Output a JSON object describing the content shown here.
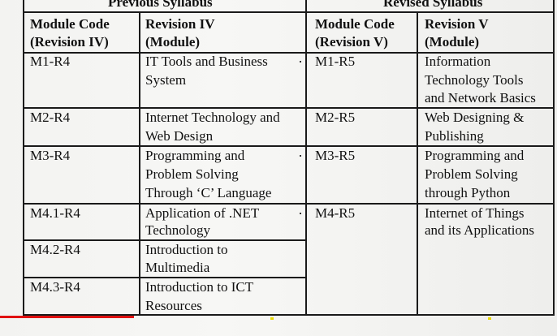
{
  "table": {
    "group_headers": {
      "previous": "Previous Syllabus",
      "revised": "Revised Syllabus"
    },
    "column_headers": {
      "prev_code": [
        "Module Code",
        "(Revision IV)"
      ],
      "prev_module": [
        "Revision IV",
        "(Module)"
      ],
      "rev_code": [
        "Module Code",
        "(Revision V)"
      ],
      "rev_module": [
        "Revision V",
        "(Module)"
      ]
    },
    "previous_rows": [
      {
        "code": "M1-R4",
        "module": [
          "IT Tools and Business",
          "System"
        ]
      },
      {
        "code": "M2-R4",
        "module": [
          "Internet Technology and",
          "Web Design"
        ]
      },
      {
        "code": "M3-R4",
        "module": [
          "Programming and",
          "Problem Solving",
          "Through ‘C’ Language"
        ]
      },
      {
        "code": "M4.1-R4",
        "module": [
          "Application of .NET",
          "Technology"
        ]
      },
      {
        "code": "M4.2-R4",
        "module": [
          "Introduction to",
          "Multimedia"
        ]
      },
      {
        "code": "M4.3-R4",
        "module": [
          "Introduction to ICT",
          "Resources"
        ]
      }
    ],
    "revised_rows": [
      {
        "code": "M1-R5",
        "module": [
          "Information",
          "Technology Tools",
          "and Network Basics"
        ]
      },
      {
        "code": "M2-R5",
        "module": [
          "Web Designing &",
          "Publishing"
        ]
      },
      {
        "code": "M3-R5",
        "module": [
          "Programming and",
          "Problem Solving",
          "through Python"
        ]
      },
      {
        "code": "M4-R5",
        "module": [
          "Internet of Things",
          "and its Applications"
        ]
      }
    ]
  }
}
